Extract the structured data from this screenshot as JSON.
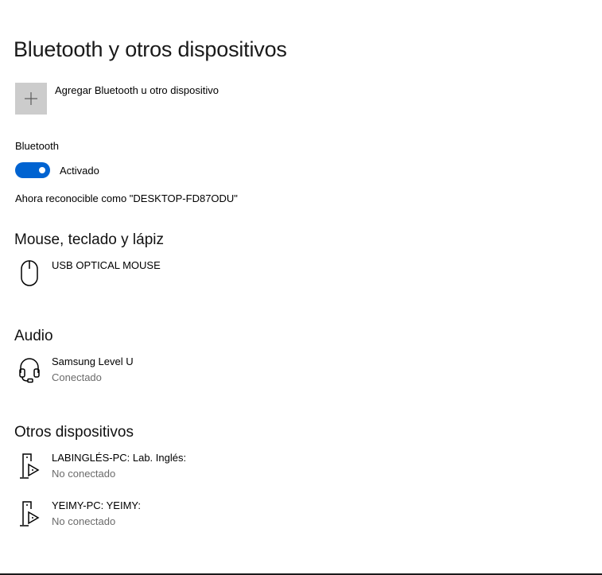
{
  "page": {
    "title": "Bluetooth y otros dispositivos"
  },
  "add_device": {
    "label": "Agregar Bluetooth u otro dispositivo",
    "icon": "plus-icon"
  },
  "bluetooth": {
    "label": "Bluetooth",
    "toggle_state": "Activado",
    "toggle_on": true,
    "accent_color": "#0063d1",
    "discoverable_text": "Ahora reconocible como \"DESKTOP-FD87ODU\""
  },
  "sections": {
    "mouse": {
      "heading": "Mouse, teclado y lápiz",
      "devices": [
        {
          "name": "USB OPTICAL MOUSE",
          "icon": "mouse-icon"
        }
      ]
    },
    "audio": {
      "heading": "Audio",
      "devices": [
        {
          "name": "Samsung Level U",
          "status": "Conectado",
          "icon": "headset-icon"
        }
      ]
    },
    "other": {
      "heading": "Otros dispositivos",
      "devices": [
        {
          "name": "LABINGLÉS-PC: Lab. Inglés:",
          "status": "No conectado",
          "icon": "media-device-icon"
        },
        {
          "name": "YEIMY-PC: YEIMY:",
          "status": "No conectado",
          "icon": "media-device-icon"
        }
      ]
    }
  }
}
